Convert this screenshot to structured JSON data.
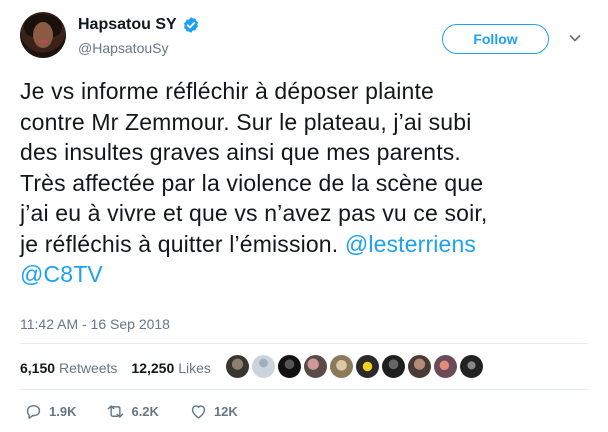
{
  "user": {
    "display_name": "Hapsatou SY",
    "handle": "@HapsatouSy",
    "verified": true
  },
  "follow_button": {
    "label": "Follow"
  },
  "tweet": {
    "lines": [
      {
        "text": "Je vs informe réfléchir à déposer plainte"
      },
      {
        "text": "contre Mr Zemmour. Sur le plateau, j’ai subi"
      },
      {
        "text": "des insultes graves ainsi que mes parents."
      },
      {
        "text": "Très affectée par la violence de la scène que"
      },
      {
        "text": "j’ai eu à vivre et que vs n’avez pas vu ce soir,"
      },
      {
        "text": "je réfléchis à quitter l’émission. ",
        "mention": "@lesterriens"
      },
      {
        "mention": "@C8TV"
      }
    ],
    "timestamp": "11:42 AM - 16 Sep 2018"
  },
  "stats": {
    "retweets_count": "6,150",
    "retweets_label": "Retweets",
    "likes_count": "12,250",
    "likes_label": "Likes"
  },
  "liker_avatars": [
    "avatar-1",
    "avatar-2",
    "avatar-3",
    "avatar-4",
    "avatar-5",
    "avatar-6",
    "avatar-7",
    "avatar-8",
    "avatar-9",
    "avatar-10"
  ],
  "actions": {
    "reply_count": "1.9K",
    "retweet_count": "6.2K",
    "like_count": "12K"
  },
  "colors": {
    "accent": "#1da1f2",
    "muted": "#657786",
    "text": "#14171a",
    "divider": "#e6ecf0"
  }
}
